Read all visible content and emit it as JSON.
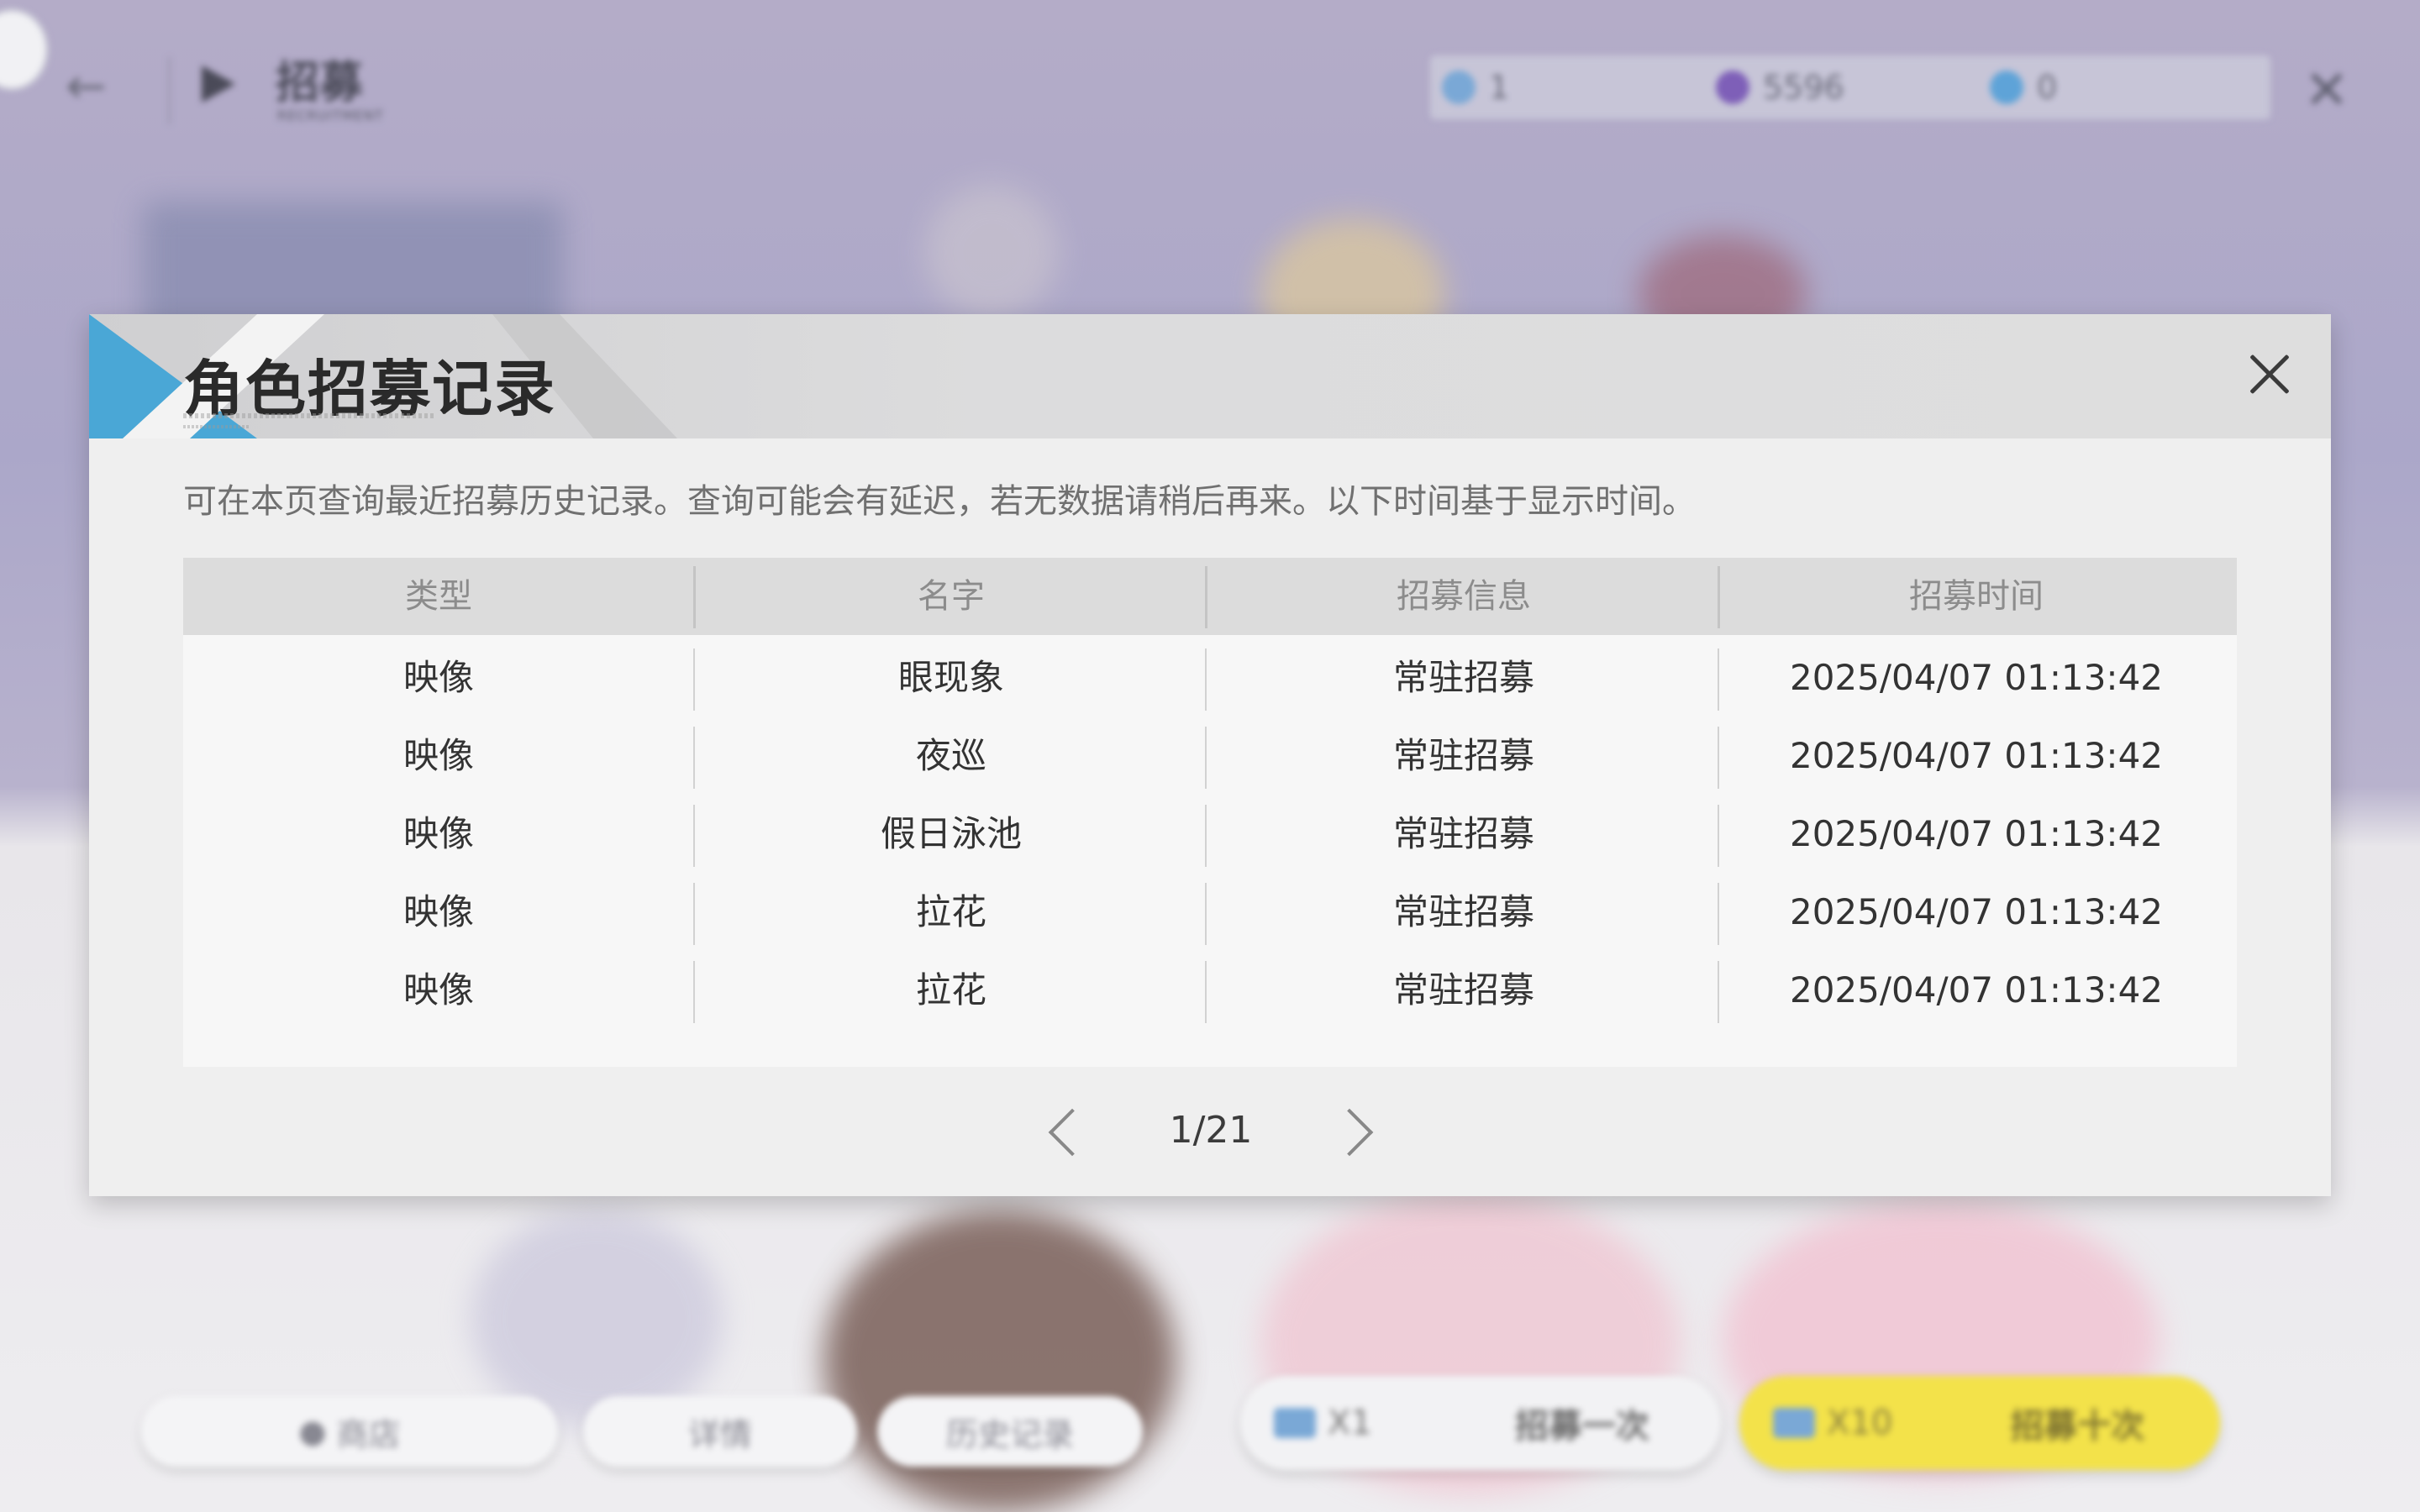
{
  "background": {
    "title": "招募",
    "subtitle": "RECRUITMENT",
    "currencies": [
      {
        "icon": "ticket-icon",
        "value": "1",
        "color": "#7aa8d6"
      },
      {
        "icon": "crystal-icon",
        "value": "5596",
        "color": "#7e5fb8"
      },
      {
        "icon": "diamond-icon",
        "value": "0",
        "color": "#5ea3d8"
      }
    ],
    "bottom_buttons": {
      "shop": "商店",
      "details": "详情",
      "history": "历史记录"
    },
    "recruit_once": {
      "count": "X1",
      "label": "招募一次"
    },
    "recruit_ten": {
      "count": "X10",
      "label": "招募十次"
    }
  },
  "dialog": {
    "title": "角色招募记录",
    "description": "可在本页查询最近招募历史记录。查询可能会有延迟，若无数据请稍后再来。以下时间基于显示时间。",
    "columns": [
      "类型",
      "名字",
      "招募信息",
      "招募时间"
    ],
    "rows": [
      [
        "映像",
        "眼现象",
        "常驻招募",
        "2025/04/07 01:13:42"
      ],
      [
        "映像",
        "夜巡",
        "常驻招募",
        "2025/04/07 01:13:42"
      ],
      [
        "映像",
        "假日泳池",
        "常驻招募",
        "2025/04/07 01:13:42"
      ],
      [
        "映像",
        "拉花",
        "常驻招募",
        "2025/04/07 01:13:42"
      ],
      [
        "映像",
        "拉花",
        "常驻招募",
        "2025/04/07 01:13:42"
      ]
    ],
    "pagination": {
      "current": 1,
      "total": 21,
      "label": "1/21"
    }
  },
  "colors": {
    "accent_blue": "#4aa7d6",
    "recruit_ten_yellow": "#f3e24a",
    "header_gray": "#dcdcdc"
  }
}
